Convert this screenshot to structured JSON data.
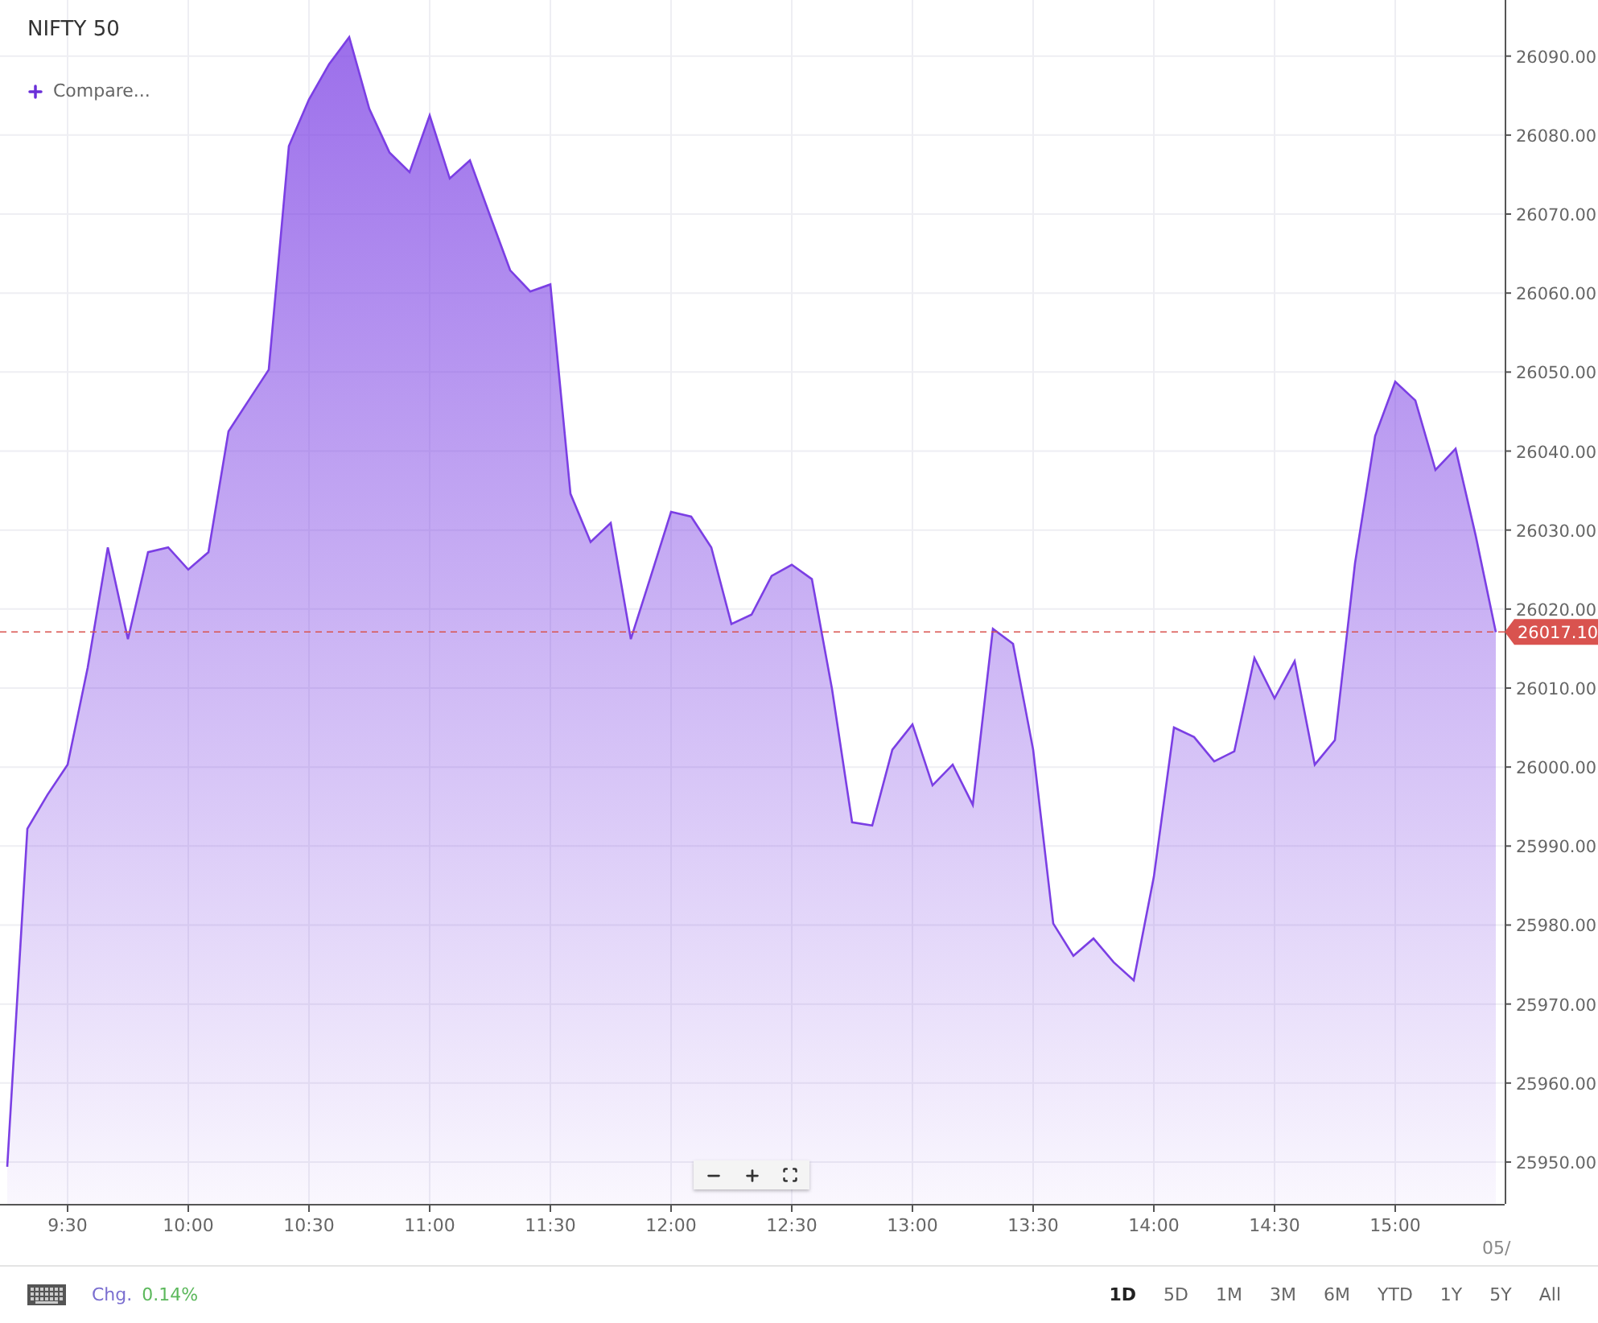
{
  "compare": {
    "label": "Compare..."
  },
  "chart": {
    "chart_data": {
      "type": "area",
      "title": "NIFTY 50",
      "grid": true,
      "x": [
        555,
        560,
        565,
        570,
        575,
        580,
        585,
        590,
        595,
        600,
        605,
        610,
        615,
        620,
        625,
        630,
        635,
        640,
        645,
        650,
        655,
        660,
        665,
        670,
        675,
        680,
        685,
        690,
        695,
        700,
        705,
        710,
        715,
        720,
        725,
        730,
        735,
        740,
        745,
        750,
        755,
        760,
        765,
        770,
        775,
        780,
        785,
        790,
        795,
        800,
        805,
        810,
        815,
        820,
        825,
        830,
        835,
        840,
        845,
        850,
        855,
        860,
        865,
        870,
        875,
        880,
        885,
        890,
        895,
        900,
        905,
        910,
        915,
        920,
        925
      ],
      "series": [
        {
          "color": "#7b3fe4",
          "values": [
            25949.4,
            25992.2,
            25996.5,
            26000.3,
            26012.6,
            26027.8,
            26016.2,
            26027.2,
            26027.8,
            26025.0,
            26027.2,
            26042.5,
            26046.4,
            26050.3,
            26078.6,
            26084.5,
            26089.0,
            26092.4,
            26083.3,
            26077.8,
            26075.3,
            26082.5,
            26074.5,
            26076.8,
            26069.8,
            26062.9,
            26060.2,
            26061.1,
            26034.6,
            26028.5,
            26030.9,
            26016.2,
            26024.2,
            26032.3,
            26031.7,
            26027.8,
            26018.1,
            26019.3,
            26024.2,
            26025.6,
            26023.8,
            26009.9,
            25993.0,
            25992.6,
            26002.2,
            26005.4,
            25997.7,
            26000.3,
            25995.2,
            26017.5,
            26015.6,
            26002.2,
            25980.2,
            25976.1,
            25978.3,
            25975.3,
            25973.0,
            25986.1,
            26005.0,
            26003.8,
            26000.7,
            26002.0,
            26013.8,
            26008.7,
            26013.4,
            26000.3,
            26003.4,
            26025.8,
            26041.9,
            26048.8,
            26046.4,
            26037.6,
            26040.3,
            26029.3,
            26017.1
          ]
        }
      ],
      "xlim": [
        553.2,
        927.2
      ],
      "ylim": [
        25944.7,
        26097.1
      ],
      "xticks": [
        {
          "value": 570,
          "label": "9:30"
        },
        {
          "value": 600,
          "label": "10:00"
        },
        {
          "value": 630,
          "label": "10:30"
        },
        {
          "value": 660,
          "label": "11:00"
        },
        {
          "value": 690,
          "label": "11:30"
        },
        {
          "value": 720,
          "label": "12:00"
        },
        {
          "value": 750,
          "label": "12:30"
        },
        {
          "value": 780,
          "label": "13:00"
        },
        {
          "value": 810,
          "label": "13:30"
        },
        {
          "value": 840,
          "label": "14:00"
        },
        {
          "value": 870,
          "label": "14:30"
        },
        {
          "value": 900,
          "label": "15:00"
        }
      ],
      "yticks": [
        {
          "value": 25950,
          "label": "25950.00"
        },
        {
          "value": 25960,
          "label": "25960.00"
        },
        {
          "value": 25970,
          "label": "25970.00"
        },
        {
          "value": 25980,
          "label": "25980.00"
        },
        {
          "value": 25990,
          "label": "25990.00"
        },
        {
          "value": 26000,
          "label": "26000.00"
        },
        {
          "value": 26010,
          "label": "26010.00"
        },
        {
          "value": 26020,
          "label": "26020.00"
        },
        {
          "value": 26030,
          "label": "26030.00"
        },
        {
          "value": 26040,
          "label": "26040.00"
        },
        {
          "value": 26050,
          "label": "26050.00"
        },
        {
          "value": 26060,
          "label": "26060.00"
        },
        {
          "value": 26070,
          "label": "26070.00"
        },
        {
          "value": 26080,
          "label": "26080.00"
        },
        {
          "value": 26090,
          "label": "26090.00"
        }
      ],
      "ref_lines": [
        {
          "axis": "y",
          "value": 26017.1,
          "label": "26017.10",
          "color": "#d9534f"
        }
      ]
    },
    "date_label": "05/"
  },
  "footer": {
    "change_label": "Chg.",
    "change_value": "0.14%",
    "ranges": [
      {
        "label": "1D",
        "selected": true
      },
      {
        "label": "5D",
        "selected": false
      },
      {
        "label": "1M",
        "selected": false
      },
      {
        "label": "3M",
        "selected": false
      },
      {
        "label": "6M",
        "selected": false
      },
      {
        "label": "YTD",
        "selected": false
      },
      {
        "label": "1Y",
        "selected": false
      },
      {
        "label": "5Y",
        "selected": false
      },
      {
        "label": "All",
        "selected": false
      }
    ]
  }
}
